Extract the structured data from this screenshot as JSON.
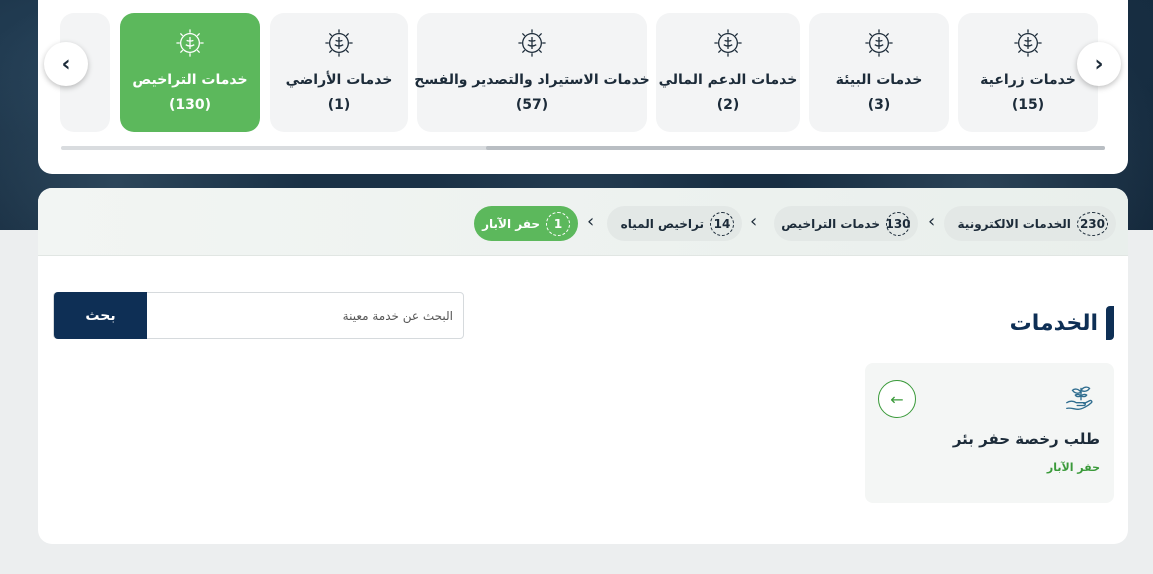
{
  "categories": [
    {
      "name": "خدمات زراعية",
      "count": "(15)"
    },
    {
      "name": "خدمات البيئة",
      "count": "(3)"
    },
    {
      "name": "خدمات الدعم المالي",
      "count": "(2)"
    },
    {
      "name": "خدمات الاستيراد والتصدير والفسح",
      "count": "(57)"
    },
    {
      "name": "خدمات الأراضي",
      "count": "(1)"
    },
    {
      "name": "خدمات التراخيص",
      "count": "(130)",
      "active": true
    },
    {
      "name": "",
      "count": ""
    }
  ],
  "nav": {
    "prev_icon": "chevron-left-icon",
    "next_icon": "chevron-right-icon",
    "prev_glyph": "‹",
    "next_glyph": "›"
  },
  "breadcrumb": [
    {
      "label": "الخدمات الالكترونية",
      "count": "230"
    },
    {
      "label": "خدمات التراخيص",
      "count": "130"
    },
    {
      "label": "تراخيص المياه",
      "count": "14"
    },
    {
      "label": "حفر الآبار",
      "count": "1",
      "active": true
    }
  ],
  "search": {
    "placeholder": "البحث عن خدمة معينة",
    "value": "",
    "button_label": "بحث"
  },
  "section": {
    "title": "الخدمات"
  },
  "services": [
    {
      "title": "طلب رخصة حفر بئر",
      "category": "حفر الآبار",
      "icon": "plant-hand-icon",
      "action_icon": "arrow-left-icon",
      "action_glyph": "←"
    }
  ],
  "colors": {
    "accent_green": "#5cb85c",
    "navy": "#0e2f55",
    "text": "#1c2b39"
  }
}
